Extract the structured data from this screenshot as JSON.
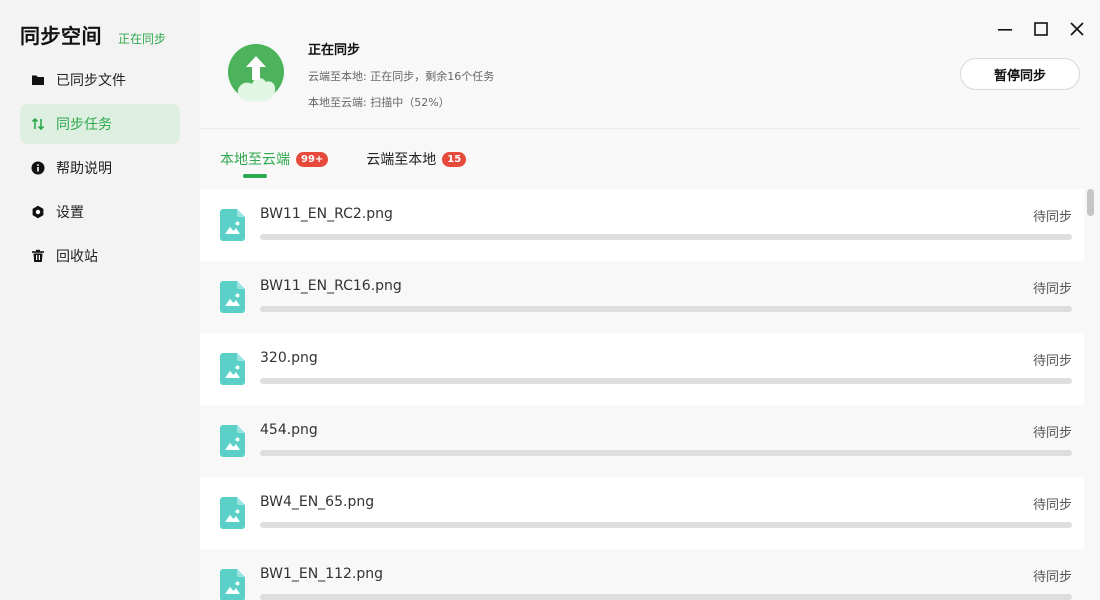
{
  "sidebar": {
    "title": "同步空间",
    "status": "正在同步",
    "items": [
      {
        "label": "已同步文件",
        "icon": "folder-icon",
        "active": false
      },
      {
        "label": "同步任务",
        "icon": "sync-arrows-icon",
        "active": true
      },
      {
        "label": "帮助说明",
        "icon": "info-icon",
        "active": false
      },
      {
        "label": "设置",
        "icon": "settings-icon",
        "active": false
      },
      {
        "label": "回收站",
        "icon": "trash-icon",
        "active": false
      }
    ]
  },
  "header": {
    "title": "正在同步",
    "cloud_to_local": "云端至本地: 正在同步，剩余16个任务",
    "local_to_cloud": "本地至云端: 扫描中（52%）",
    "pause_label": "暂停同步"
  },
  "window_controls": {
    "minimize_icon": "minimize-icon",
    "maximize_icon": "maximize-icon",
    "close_icon": "close-icon"
  },
  "tabs": [
    {
      "label": "本地至云端",
      "badge": "99+",
      "active": true
    },
    {
      "label": "云端至本地",
      "badge": "15",
      "active": false
    }
  ],
  "files": [
    {
      "name": "BW11_EN_RC2.png",
      "status": "待同步",
      "progress": 0
    },
    {
      "name": "BW11_EN_RC16.png",
      "status": "待同步",
      "progress": 0
    },
    {
      "name": "320.png",
      "status": "待同步",
      "progress": 0
    },
    {
      "name": "454.png",
      "status": "待同步",
      "progress": 0
    },
    {
      "name": "BW4_EN_65.png",
      "status": "待同步",
      "progress": 0
    },
    {
      "name": "BW1_EN_112.png",
      "status": "待同步",
      "progress": 0
    }
  ],
  "colors": {
    "accent": "#2fa94e",
    "badge": "#e64a3b",
    "file_icon": "#5ad0c9"
  }
}
